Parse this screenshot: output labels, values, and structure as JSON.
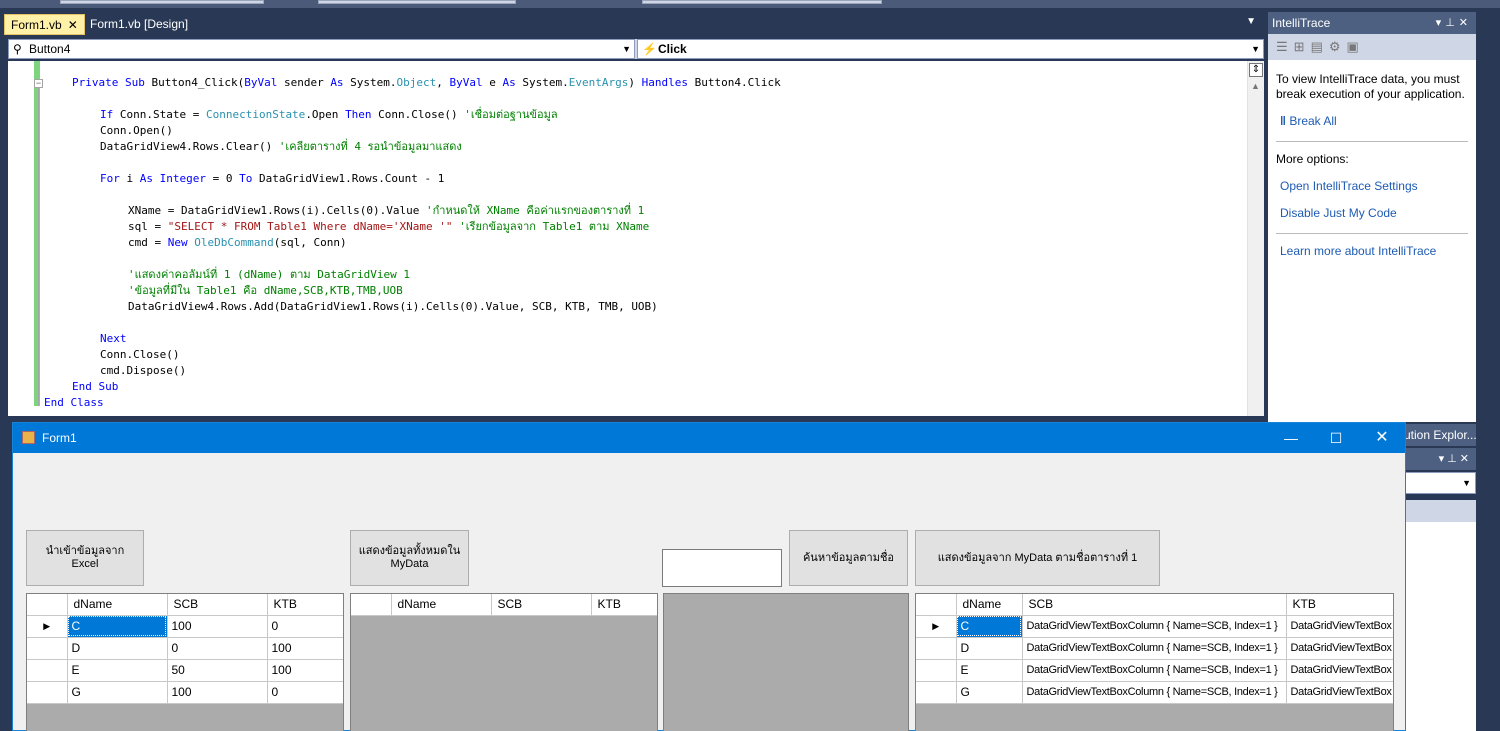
{
  "ide": {
    "tabs": [
      {
        "label": "Form1.vb",
        "close": "✕"
      },
      {
        "label": "Form1.vb [Design]"
      }
    ],
    "nav": {
      "object": "Button4",
      "method": "Click"
    }
  },
  "code": {
    "lines": [
      "Private Sub Button4_Click(ByVal sender As System.Object, ByVal e As System.EventArgs) Handles Button4.Click",
      "If Conn.State = ConnectionState.Open Then Conn.Close() 'เชื่อมต่อฐานข้อมูล",
      "Conn.Open()",
      "DataGridView4.Rows.Clear() 'เคลียตารางที่ 4 รอนำข้อมูลมาแสดง",
      "For i As Integer = 0 To DataGridView1.Rows.Count - 1",
      "XName = DataGridView1.Rows(i).Cells(0).Value 'กำหนดให้ XName คือค่าแรกของตารางที่ 1",
      "sql = \"SELECT * FROM Table1 Where dName='XName '\" 'เรียกข้อมูลจาก Table1 ตาม XName",
      "cmd = New OleDbCommand(sql, Conn)",
      "'แสดงค่าคอลัมน์ที่ 1 (dName) ตาม DataGridView 1",
      "'ข้อมูลที่มีใน Table1 คือ dName,SCB,KTB,TMB,UOB",
      "DataGridView4.Rows.Add(DataGridView1.Rows(i).Cells(0).Value, SCB, KTB, TMB, UOB)",
      "Next",
      "Conn.Close()",
      "cmd.Dispose()",
      "End Sub",
      "End Class"
    ]
  },
  "intellitrace": {
    "title": "IntelliTrace",
    "message": "To view IntelliTrace data, you must break execution of your application.",
    "break_all": "Break All",
    "more_options": "More options:",
    "open_settings": "Open IntelliTrace Settings",
    "disable_jmc": "Disable Just My Code",
    "learn_more": "Learn more about IntelliTrace"
  },
  "solution_explorer": {
    "title": "ution Explor..."
  },
  "form": {
    "title": "Form1",
    "buttons": {
      "import_excel": "นำเข้าข้อมูลจาก Excel",
      "show_all": "แสดงข้อมูลทั้งหมดใน MyData",
      "search": "ค้นหาข้อมูลตามชื่อ",
      "show_from_table1": "แสดงข้อมูลจาก MyData ตามชื่อตารางที่ 1"
    },
    "search_value": "",
    "grid1": {
      "columns": [
        "dName",
        "SCB",
        "KTB"
      ],
      "rows": [
        [
          "C",
          "100",
          "0"
        ],
        [
          "D",
          "0",
          "100"
        ],
        [
          "E",
          "50",
          "100"
        ],
        [
          "G",
          "100",
          "0"
        ]
      ]
    },
    "grid2": {
      "columns": [
        "dName",
        "SCB",
        "KTB"
      ]
    },
    "grid4": {
      "columns": [
        "dName",
        "SCB",
        "KTB"
      ],
      "rows": [
        [
          "C",
          "DataGridViewTextBoxColumn { Name=SCB, Index=1 }",
          "DataGridViewTextBox"
        ],
        [
          "D",
          "DataGridViewTextBoxColumn { Name=SCB, Index=1 }",
          "DataGridViewTextBox"
        ],
        [
          "E",
          "DataGridViewTextBoxColumn { Name=SCB, Index=1 }",
          "DataGridViewTextBox"
        ],
        [
          "G",
          "DataGridViewTextBoxColumn { Name=SCB, Index=1 }",
          "DataGridViewTextBox"
        ]
      ]
    }
  },
  "colors": {
    "ide_background": "#293955",
    "form_titlebar": "#0078d7",
    "selection": "#0078d7",
    "keyword": "#0000ff",
    "comment": "#008000",
    "string": "#a31515",
    "type": "#2b91af"
  }
}
